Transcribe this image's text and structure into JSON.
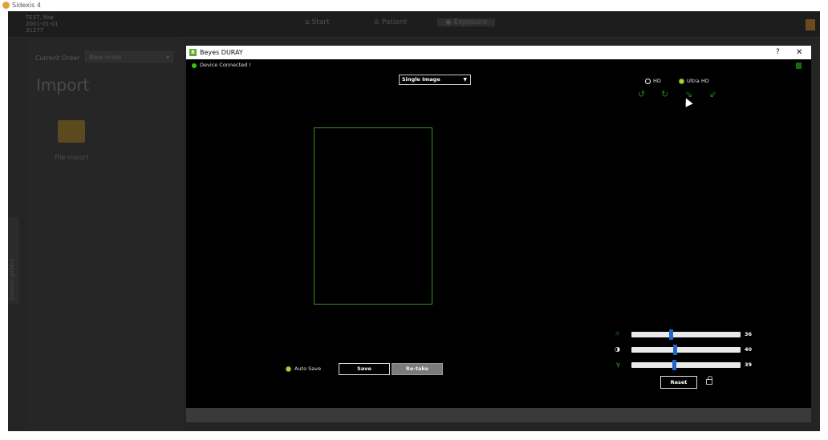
{
  "os": {
    "app_title": "Sidexis 4"
  },
  "background": {
    "patient": {
      "name": "TEST, Niw",
      "dob": "2001-01-01",
      "id": "31277"
    },
    "nav": {
      "start": "Start",
      "patient": "Patient",
      "exposure": "Exposure"
    },
    "current_order_label": "Current Order",
    "order_select_value": "New order",
    "import_heading": "Import",
    "file_import_label": "File import",
    "session_gallery_label": "Session gallery"
  },
  "dialog": {
    "title": "Beyes DURAY",
    "help": "?",
    "close": "✕",
    "status": "Device Connected !",
    "mode_select": "Single Image",
    "resolution": {
      "hd": "HD",
      "ultra_hd": "Ultra HD",
      "selected": "Ultra HD"
    },
    "rotate_icons": [
      "↺",
      "↻",
      "⇘",
      "⇙"
    ],
    "auto_save_label": "Auto Save",
    "save_button": "Save",
    "retake_button": "Re-take",
    "sliders": [
      {
        "name": "brightness",
        "icon": "☼",
        "value": "36",
        "fraction": 0.36,
        "color": "#1f8a1f"
      },
      {
        "name": "contrast",
        "icon": "◑",
        "value": "40",
        "fraction": 0.4,
        "color": "#ffffff"
      },
      {
        "name": "gamma",
        "icon": "γ",
        "value": "39",
        "fraction": 0.39,
        "color": "#39c21b"
      }
    ],
    "reset_button": "Reset",
    "accent_color": "#39c21b"
  }
}
